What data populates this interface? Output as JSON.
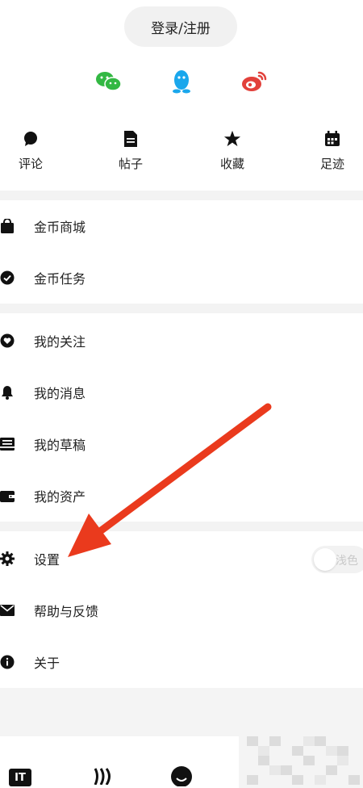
{
  "header": {
    "login_label": "登录/注册"
  },
  "social_logins": [
    {
      "icon": "wechat-icon",
      "color": "#33b843"
    },
    {
      "icon": "qq-icon",
      "color": "#1aa7ec"
    },
    {
      "icon": "weibo-icon",
      "color": "#e2413b"
    }
  ],
  "quick_actions": [
    {
      "icon": "comment-icon",
      "label": "评论"
    },
    {
      "icon": "post-icon",
      "label": "帖子"
    },
    {
      "icon": "star-icon",
      "label": "收藏"
    },
    {
      "icon": "calendar-icon",
      "label": "足迹"
    }
  ],
  "menu": {
    "coin_mall": "金币商城",
    "coin_tasks": "金币任务",
    "my_follows": "我的关注",
    "my_messages": "我的消息",
    "my_drafts": "我的草稿",
    "my_assets": "我的资产",
    "settings": "设置",
    "help_feedback": "帮助与反馈",
    "about": "关于"
  },
  "theme_toggle": {
    "label": "浅色",
    "on": false
  },
  "bottom_nav": [
    {
      "icon": "it-logo-icon",
      "label": "IT"
    },
    {
      "icon": "wave-icon"
    },
    {
      "icon": "smile-icon"
    }
  ],
  "annotation": {
    "arrow_color": "#ea3a1d"
  }
}
